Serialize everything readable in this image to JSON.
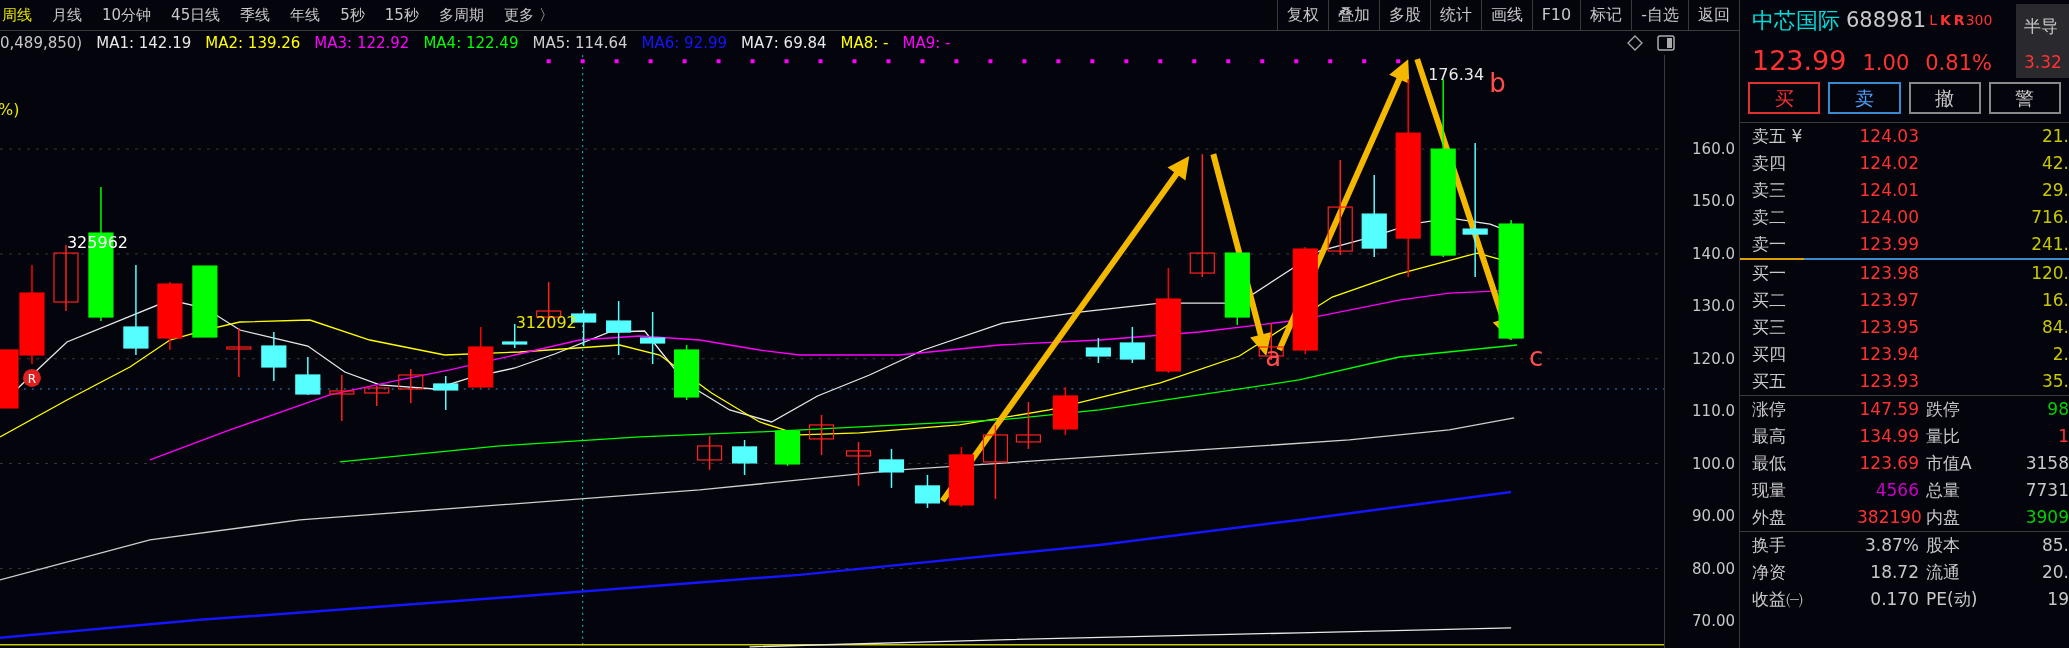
{
  "period_tabs": [
    {
      "label": "周线",
      "selected": true
    },
    {
      "label": "月线",
      "selected": false
    },
    {
      "label": "10分钟",
      "selected": false
    },
    {
      "label": "45日线",
      "selected": false
    },
    {
      "label": "季线",
      "selected": false
    },
    {
      "label": "年线",
      "selected": false
    },
    {
      "label": "5秒",
      "selected": false
    },
    {
      "label": "15秒",
      "selected": false
    },
    {
      "label": "多周期",
      "selected": false
    },
    {
      "label": "更多 〉",
      "selected": false
    }
  ],
  "toolbar_buttons": [
    "复权",
    "叠加",
    "多股",
    "统计",
    "画线",
    "F10",
    "标记",
    "-自选",
    "返回"
  ],
  "ma_legend": {
    "prefix": "0,489,850)",
    "items": [
      {
        "label": "MA1: 142.19",
        "color": "#e8e8e8"
      },
      {
        "label": "MA2: 139.26",
        "color": "#ffff00"
      },
      {
        "label": "MA3: 122.92",
        "color": "#ff00ff"
      },
      {
        "label": "MA4: 122.49",
        "color": "#00ff00"
      },
      {
        "label": "MA5: 114.64",
        "color": "#cfcfcf"
      },
      {
        "label": "MA6: 92.99",
        "color": "#1515ff"
      },
      {
        "label": "MA7: 69.84",
        "color": "#e8e8e8"
      },
      {
        "label": "MA8: -",
        "color": "#ffff00"
      },
      {
        "label": "MA9: -",
        "color": "#ff00ff"
      }
    ]
  },
  "chart": {
    "percent_label": "%)",
    "y_ticks": [
      "160.0",
      "150.0",
      "140.0",
      "130.0",
      "120.0",
      "110.0",
      "100.0",
      "90.00",
      "80.00",
      "70.00"
    ],
    "value_labels": [
      "325962",
      "312092",
      "176.34"
    ],
    "wave_labels": [
      "a",
      "b",
      "c"
    ],
    "marker": "R"
  },
  "quote": {
    "name": "中芯国际",
    "code": "688981",
    "flags": [
      "L",
      "K",
      "R",
      "300"
    ],
    "price": "123.99",
    "change": "1.00",
    "change_pct": "0.81%",
    "sector": {
      "name": "半导",
      "change": "3.32"
    }
  },
  "trade_buttons": [
    {
      "label": "买",
      "kind": "buy"
    },
    {
      "label": "卖",
      "kind": "sell"
    },
    {
      "label": "撤",
      "kind": "cancel"
    },
    {
      "label": "警",
      "kind": "alert"
    }
  ],
  "asks": [
    {
      "label": "卖五 ¥",
      "price": "124.03",
      "volume": "21."
    },
    {
      "label": "卖四",
      "price": "124.02",
      "volume": "42."
    },
    {
      "label": "卖三",
      "price": "124.01",
      "volume": "29."
    },
    {
      "label": "卖二",
      "price": "124.00",
      "volume": "716."
    },
    {
      "label": "卖一",
      "price": "123.99",
      "volume": "241."
    }
  ],
  "bids": [
    {
      "label": "买一",
      "price": "123.98",
      "volume": "120."
    },
    {
      "label": "买二",
      "price": "123.97",
      "volume": "16."
    },
    {
      "label": "买三",
      "price": "123.95",
      "volume": "84."
    },
    {
      "label": "买四",
      "price": "123.94",
      "volume": "2."
    },
    {
      "label": "买五",
      "price": "123.93",
      "volume": "35."
    }
  ],
  "stats_groups": [
    [
      [
        {
          "label": "涨停",
          "value": "147.59",
          "color": "#ff3232"
        },
        {
          "label": "跌停",
          "value": "98",
          "color": "#00d000"
        }
      ],
      [
        {
          "label": "最高",
          "value": "134.99",
          "color": "#ff3232"
        },
        {
          "label": "量比",
          "value": "1",
          "color": "#ff3232"
        }
      ],
      [
        {
          "label": "最低",
          "value": "123.69",
          "color": "#ff3232"
        },
        {
          "label": "市值A",
          "value": "3158",
          "color": "#c8c8c8"
        }
      ],
      [
        {
          "label": "现量",
          "value": "4566",
          "color": "#cc00cc"
        },
        {
          "label": "总量",
          "value": "7731",
          "color": "#c8c8c8"
        }
      ],
      [
        {
          "label": "外盘",
          "value": "382190",
          "color": "#ff3232"
        },
        {
          "label": "内盘",
          "value": "3909",
          "color": "#00d000"
        }
      ]
    ],
    [
      [
        {
          "label": "换手",
          "value": "3.87%",
          "color": "#c8c8c8"
        },
        {
          "label": "股本",
          "value": "85.",
          "color": "#c8c8c8"
        }
      ],
      [
        {
          "label": "净资",
          "value": "18.72",
          "color": "#c8c8c8"
        },
        {
          "label": "流通",
          "value": "20.",
          "color": "#c8c8c8"
        }
      ],
      [
        {
          "label": "收益㈠",
          "value": "0.170",
          "color": "#c8c8c8"
        },
        {
          "label": "PE(动)",
          "value": "19",
          "color": "#c8c8c8"
        }
      ]
    ]
  ]
}
